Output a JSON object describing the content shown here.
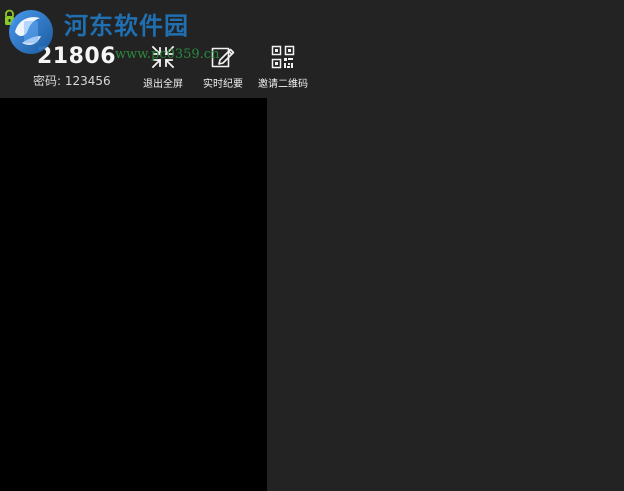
{
  "meeting": {
    "id": "21806",
    "password_label": "密码: 123456"
  },
  "toolbar": {
    "buttons": [
      {
        "label": "退出全屏",
        "icon": "exit-fullscreen-icon"
      },
      {
        "label": "实时纪要",
        "icon": "edit-note-icon"
      },
      {
        "label": "邀请二维码",
        "icon": "qr-code-icon"
      }
    ]
  },
  "watermark": {
    "brand": "河东软件园",
    "url": "www.pc0359.cn"
  },
  "colors": {
    "topbar": "#232323",
    "video_pane": "#000000",
    "side_pane": "#232323",
    "brand_blue": "#1f6fb1",
    "url_green": "#2b8a3e",
    "lock_green": "#8ac926"
  },
  "icons": {
    "lock": "lock-icon",
    "logo": "logo-icon"
  }
}
